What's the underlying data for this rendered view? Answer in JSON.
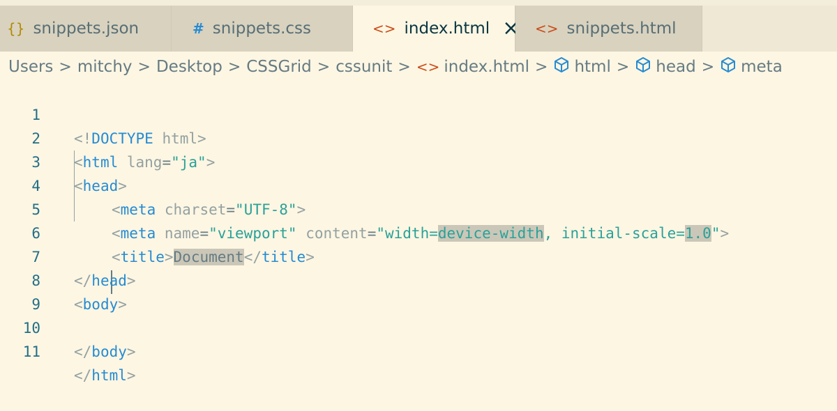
{
  "tabs": [
    {
      "label": "snippets.json",
      "icon": "braces-icon",
      "icon_glyph": "{}",
      "icon_color": "#b58900",
      "active": false
    },
    {
      "label": "snippets.css",
      "icon": "hash-icon",
      "icon_glyph": "#",
      "icon_color": "#268bd2",
      "active": false
    },
    {
      "label": "index.html",
      "icon": "html-angle-icon",
      "icon_glyph": "<>",
      "icon_color": "#cb4b16",
      "active": true
    },
    {
      "label": "snippets.html",
      "icon": "html-angle-icon",
      "icon_glyph": "<>",
      "icon_color": "#cb4b16",
      "active": false
    }
  ],
  "breadcrumb": {
    "items": [
      "Users",
      "mitchy",
      "Desktop",
      "CSSGrid",
      "cssunit",
      "index.html",
      "html",
      "head",
      "meta"
    ]
  },
  "editor": {
    "line_numbers": [
      "1",
      "2",
      "3",
      "4",
      "5",
      "6",
      "7",
      "8",
      "9",
      "10",
      "11"
    ],
    "lines": {
      "l1": {
        "open": "<!",
        "name": "DOCTYPE",
        "rest": " html",
        "close": ">"
      },
      "l2": {
        "open": "<",
        "name": "html",
        "attr": " lang",
        "eq": "=",
        "val": "\"ja\"",
        "close": ">"
      },
      "l3": {
        "open": "<",
        "name": "head",
        "close": ">"
      },
      "l4": {
        "open": "<",
        "name": "meta",
        "attr": " charset",
        "eq": "=",
        "val": "\"UTF-8\"",
        "close": ">"
      },
      "l5": {
        "open": "<",
        "name": "meta",
        "attr1": " name",
        "eq1": "=",
        "val1": "\"viewport\"",
        "attr2": " content",
        "eq2": "=",
        "val2a": "\"width=",
        "val2b": "device-width",
        "val2c": ", initial-scale=",
        "val2d": "1.0",
        "val2e": "\"",
        "close": ">"
      },
      "l6": {
        "open": "<",
        "name": "title",
        "close": ">",
        "text": "Document",
        "open2": "</",
        "name2": "title",
        "close2": ">"
      },
      "l7": {
        "open": "</",
        "name": "head",
        "close": ">"
      },
      "l8": {
        "open": "<",
        "name": "body",
        "close": ">"
      },
      "l10": {
        "open": "</",
        "name": "body",
        "close": ">"
      },
      "l11": {
        "open": "</",
        "name": "html",
        "close": ">"
      }
    }
  },
  "colors": {
    "background": "#fdf6e3",
    "tag": "#268bd2",
    "string": "#2aa198",
    "punctuation": "#93a1a1"
  }
}
